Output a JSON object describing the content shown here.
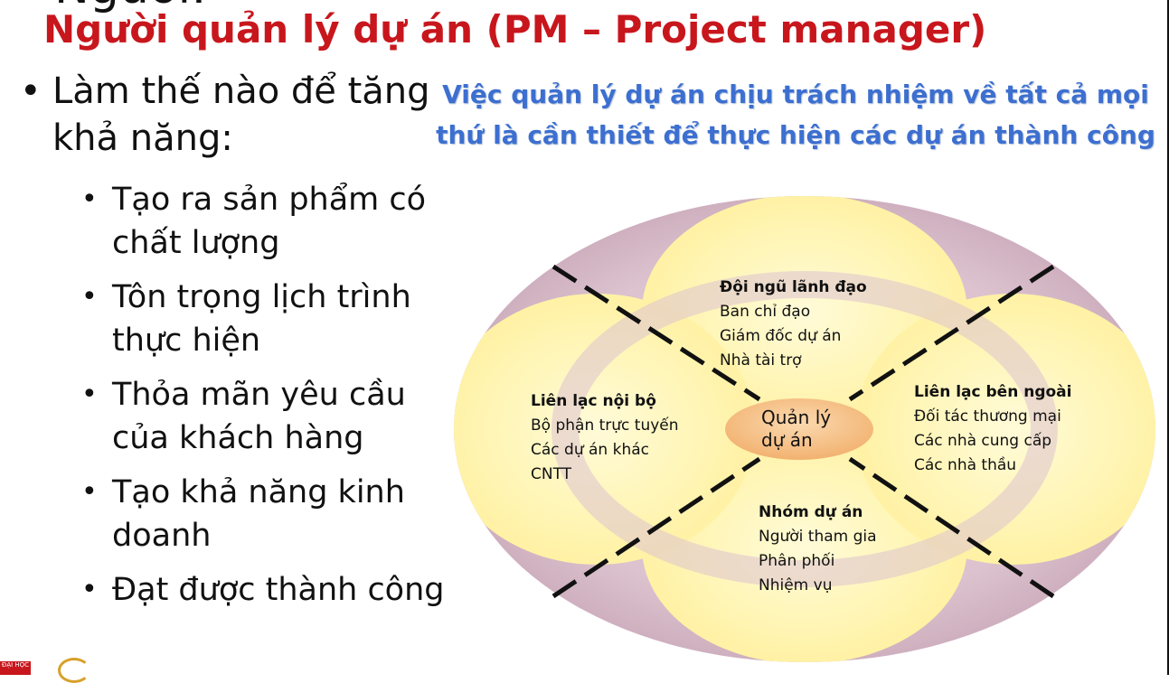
{
  "slide": {
    "title_top_cut": "Ngươi:",
    "title": "Người quản lý dự án (PM – Project manager)"
  },
  "bullets": {
    "main": "Làm thế nào để tăng khả năng:",
    "items": [
      "Tạo ra sản phẩm có chất lượng",
      "Tôn trọng lịch trình thực hiện",
      "Thỏa mãn yêu cầu của khách hàng",
      "Tạo khả năng kinh doanh",
      "Đạt được thành công"
    ]
  },
  "diagram": {
    "title": "Việc quản lý dự án chịu trách nhiệm về tất cả mọi thứ là cần thiết để thực hiện các dự án thành công",
    "center": {
      "line1": "Quản lý",
      "line2": "dự án"
    },
    "top": {
      "heading": "Đội ngũ lãnh đạo",
      "lines": [
        "Ban chỉ đạo",
        "Giám đốc dự án",
        "Nhà tài trợ"
      ]
    },
    "left": {
      "heading": "Liên lạc nội bộ",
      "lines": [
        "Bộ phận trực tuyến",
        "Các dự án khác",
        "CNTT"
      ]
    },
    "right": {
      "heading": "Liên lạc bên ngoài",
      "lines": [
        "Đối tác thương mại",
        "Các nhà cung cấp",
        "Các nhà thầu"
      ]
    },
    "bottom": {
      "heading": "Nhóm dự án",
      "lines": [
        "Người tham gia",
        "Phân phối",
        "Nhiệm vụ"
      ]
    },
    "colors": {
      "outer": "#d4b6c4",
      "petal": "#fff3a0",
      "center": "#f7c38a",
      "title": "#3c6fd0"
    }
  },
  "footer": {
    "logo_text": "ĐẠI HỌC"
  }
}
